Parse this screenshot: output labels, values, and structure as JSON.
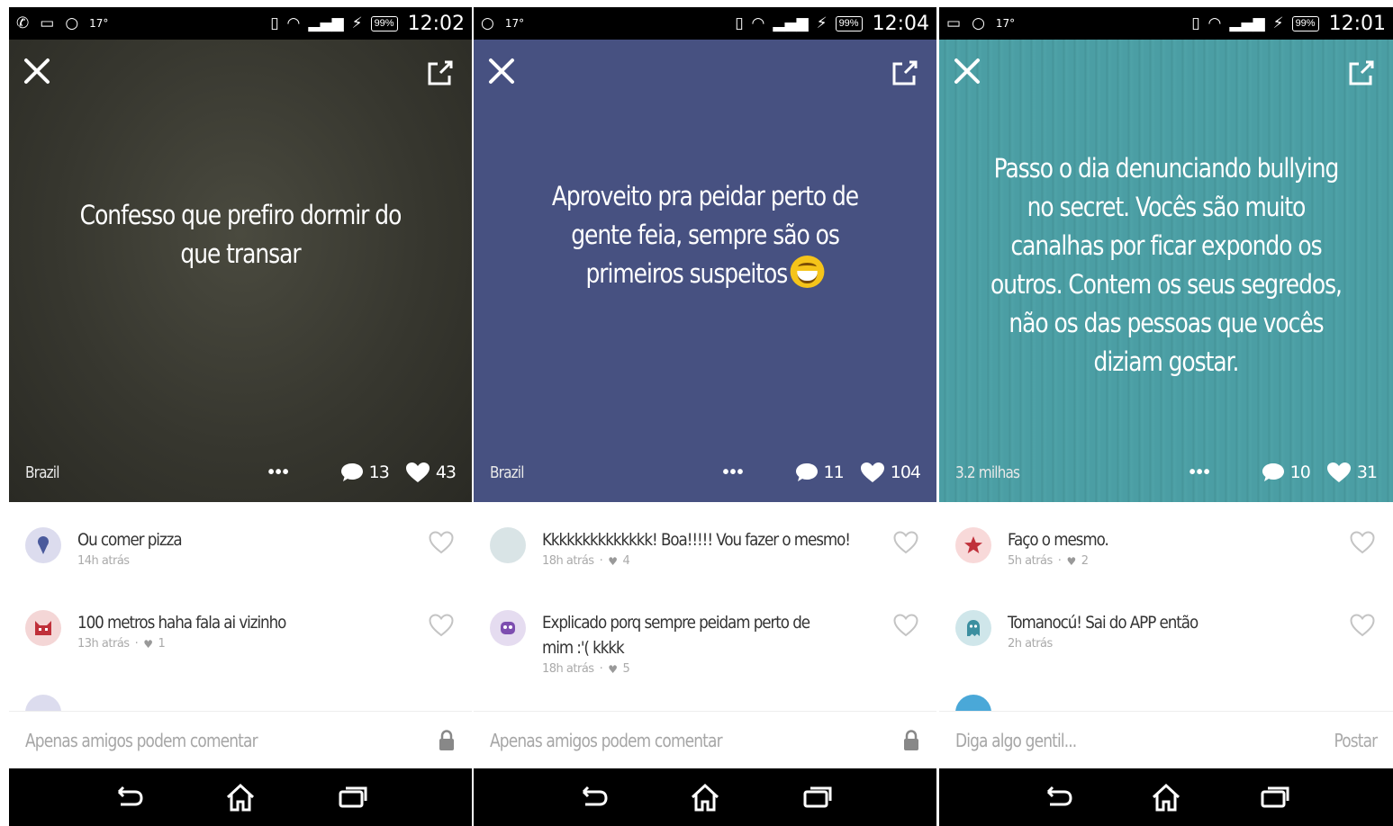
{
  "colors": {
    "card_dark": "#37372f",
    "card_purple": "#475181",
    "card_teal": "#4b9ea4",
    "status_bar": "#000000",
    "nav_bar": "#000000",
    "avatar_ice_cream_bg": "#dcdcee",
    "avatar_demon_bg": "#f4d6d6",
    "avatar_plain_bg": "#d9e4e6",
    "avatar_ghost_bg": "#e5dcf0",
    "avatar_star_bg": "#f8d9d9",
    "avatar_ghost2_bg": "#cfe6ea"
  },
  "phones": [
    {
      "status_bar": {
        "temperature": "17°",
        "battery": "99%",
        "time": "12:02"
      },
      "card": {
        "text": "Confesso que prefiro dormir do que transar",
        "location": "Brazil",
        "comment_count": "13",
        "like_count": "43"
      },
      "comments": [
        {
          "avatar_icon": "ice-cream-icon",
          "text": "Ou comer pizza",
          "time": "14h atrás",
          "likes": ""
        },
        {
          "avatar_icon": "demon-icon",
          "text": "100 metros haha fala ai vizinho",
          "time": "13h atrás",
          "likes": "1"
        }
      ],
      "input": {
        "placeholder": "Apenas amigos podem comentar"
      }
    },
    {
      "status_bar": {
        "temperature": "17°",
        "battery": "99%",
        "time": "12:04"
      },
      "card": {
        "text": "Aproveito pra peidar perto de gente feia, sempre são os primeiros suspeitos",
        "location": "Brazil",
        "comment_count": "11",
        "like_count": "104"
      },
      "comments": [
        {
          "avatar_icon": "blank-avatar-icon",
          "text": "Kkkkkkkkkkkkkk! Boa!!!!! Vou fazer o mesmo!",
          "time": "18h atrás",
          "likes": "4"
        },
        {
          "avatar_icon": "ghost-icon",
          "text": "Explicado porq sempre peidam perto de mim :'( kkkk",
          "time": "18h atrás",
          "likes": "5"
        }
      ],
      "input": {
        "placeholder": "Apenas amigos podem comentar"
      }
    },
    {
      "status_bar": {
        "temperature": "17°",
        "battery": "99%",
        "time": "12:01"
      },
      "card": {
        "text": "Passo o dia denunciando bullying no secret. Vocês são muito canalhas por ficar expondo os outros. Contem os seus segredos, não os das pessoas que vocês diziam gostar.",
        "location": "3.2 milhas",
        "comment_count": "10",
        "like_count": "31"
      },
      "comments": [
        {
          "avatar_icon": "star-icon",
          "text": "Faço o mesmo.",
          "time": "5h atrás",
          "likes": "2"
        },
        {
          "avatar_icon": "ghost-icon",
          "text": "Tomanocú! Sai do APP então",
          "time": "2h atrás",
          "likes": ""
        }
      ],
      "input": {
        "placeholder": "Diga algo gentil...",
        "post_label": "Postar"
      }
    }
  ]
}
